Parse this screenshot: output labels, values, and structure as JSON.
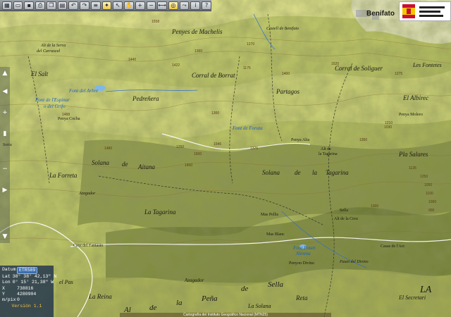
{
  "toolbar": {
    "buttons": [
      "grid-icon",
      "folder-icon",
      "save-icon",
      "print-icon",
      "copy-icon",
      "paste-icon",
      "undo-icon",
      "redo-icon",
      "layers-icon",
      "settings-icon",
      "pointer-icon",
      "hand-icon",
      "zoom-in-icon",
      "zoom-out-icon",
      "measure-icon",
      "gps-icon",
      "route-icon",
      "info-icon",
      "help-icon"
    ]
  },
  "places": {
    "benifato": "Benifato",
    "alt_serra": "Alt de la Serra",
    "del_carrascal": "del Carrascal",
    "el_salt": "El Salt",
    "penyes_machelis": "Penyes de Machelis",
    "castell_benifato": "Castell de Benifato",
    "alt_del_sol": "Alt del Sol",
    "corral_borrat": "Corral de Borrat",
    "corral_soliguer": "Corral de Soliguer",
    "les_fontetes": "Les Fontetes",
    "font_del_arbre": "Font del Arbre",
    "font_espinar": "Font de l'Espinar",
    "o_del_grifo": "o del Grifo",
    "pedrenera": "Pedreñera",
    "partagos": "Partagos",
    "el_albirec": "El Albirec",
    "penya_cocha": "Penya Cocha",
    "font_forata": "Font de Forata",
    "penya_alta": "Penya Alta",
    "alt_tagarina": "Alt de",
    "alt_tagarina2": "la Tagarina",
    "penya_molero": "Penya Molero",
    "serra": "Serra",
    "pla_salares": "Pla Salares",
    "solana": "Solana",
    "de": "de",
    "aitana": "Aitana",
    "la_forreta": "La Forreta",
    "solana_tagarina": "Solana",
    "de2": "de",
    "la": "la",
    "tagarina": "Tagarina",
    "la_tagarina": "La Tagarina",
    "mas_pellis": "Mas Pellis",
    "mas_blanc": "Mas Blanc",
    "alt_creu": "Alt de la Creu",
    "casa_fantasto": "Casa del Fantasto",
    "font_pouet": "Font Pouet",
    "alesma": "Alesma",
    "penyon_divino": "Penyon Divino",
    "pauet": "Pauet del Divino",
    "casas_arca": "Casas de l'Arc",
    "el_pas": "el Pas",
    "azagador": "Azagador",
    "la_reina": "La Reina",
    "al": "Al",
    "de3": "de",
    "la2": "la",
    "pena": "Peña",
    "de4": "de",
    "sella": "Sella",
    "la_solana": "La Solana",
    "sella_small": "Sella",
    "el_secretari": "El Secretari",
    "la_big": "LA",
    "reta": "Reta",
    "azagador2": "Azagador"
  },
  "elevations": [
    "1558",
    "1360",
    "1270",
    "1175",
    "1440",
    "1300",
    "1488",
    "1422",
    "1375",
    "1480",
    "1546",
    "1275",
    "1500",
    "1210",
    "1400",
    "1300",
    "1250",
    "1350",
    "1050",
    "1100",
    "900",
    "1000",
    "1030",
    "1126",
    "1250",
    "1520",
    "1400"
  ],
  "coords": {
    "datum_label": "Datum",
    "datum_value": "ETRS89",
    "lat_label": "Lat",
    "lat_value": "38° 38' 42,13\" N",
    "lon_label": "Lon",
    "lon_value": "0° 15' 21,38\" W",
    "x_label": "X",
    "x_value": "738816",
    "y_label": "Y",
    "y_value": "4280904",
    "z_label": "m/pix",
    "z_value": "0",
    "version": "Versión 1.1"
  },
  "status": {
    "text": "Cartografía del Instituto Geográfico Nacional (MTN25)"
  },
  "colors": {
    "terrain_light": "#d9dc86",
    "terrain_mid": "#a9b35a",
    "terrain_shadow": "#5f6a32",
    "road": "#ffffff",
    "water": "#1f5fb8",
    "urban": "#c8c8c8"
  }
}
